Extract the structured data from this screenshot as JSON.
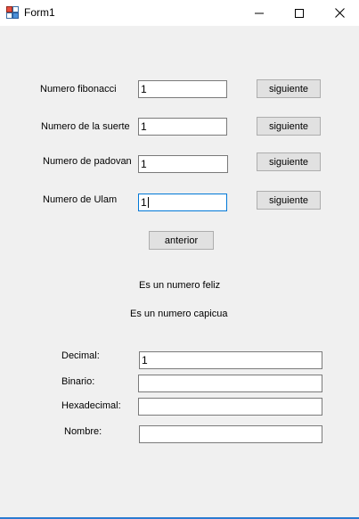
{
  "window": {
    "title": "Form1"
  },
  "series": [
    {
      "label": "Numero fibonacci",
      "value": "1",
      "button": "siguiente"
    },
    {
      "label": "Numero de la suerte",
      "value": "1",
      "button": "siguiente"
    },
    {
      "label": "Numero de padovan",
      "value": "1",
      "button": "siguiente"
    },
    {
      "label": "Numero de Ulam",
      "value": "1",
      "button": "siguiente"
    }
  ],
  "anterior_button": "anterior",
  "status": {
    "feliz": "Es un numero feliz",
    "capicua": "Es un numero capicua"
  },
  "conversion": {
    "decimal_label": "Decimal:",
    "decimal_value": "1",
    "binario_label": "Binario:",
    "binario_value": "",
    "hexadecimal_label": "Hexadecimal:",
    "hexadecimal_value": "",
    "nombre_label": "Nombre:",
    "nombre_value": ""
  },
  "icons": {
    "app": "windows-form-icon",
    "minimize": "minimize-icon",
    "maximize": "maximize-icon",
    "close": "close-icon"
  },
  "colors": {
    "focus_border": "#0078d7",
    "accent_border": "#2b7bd1"
  }
}
